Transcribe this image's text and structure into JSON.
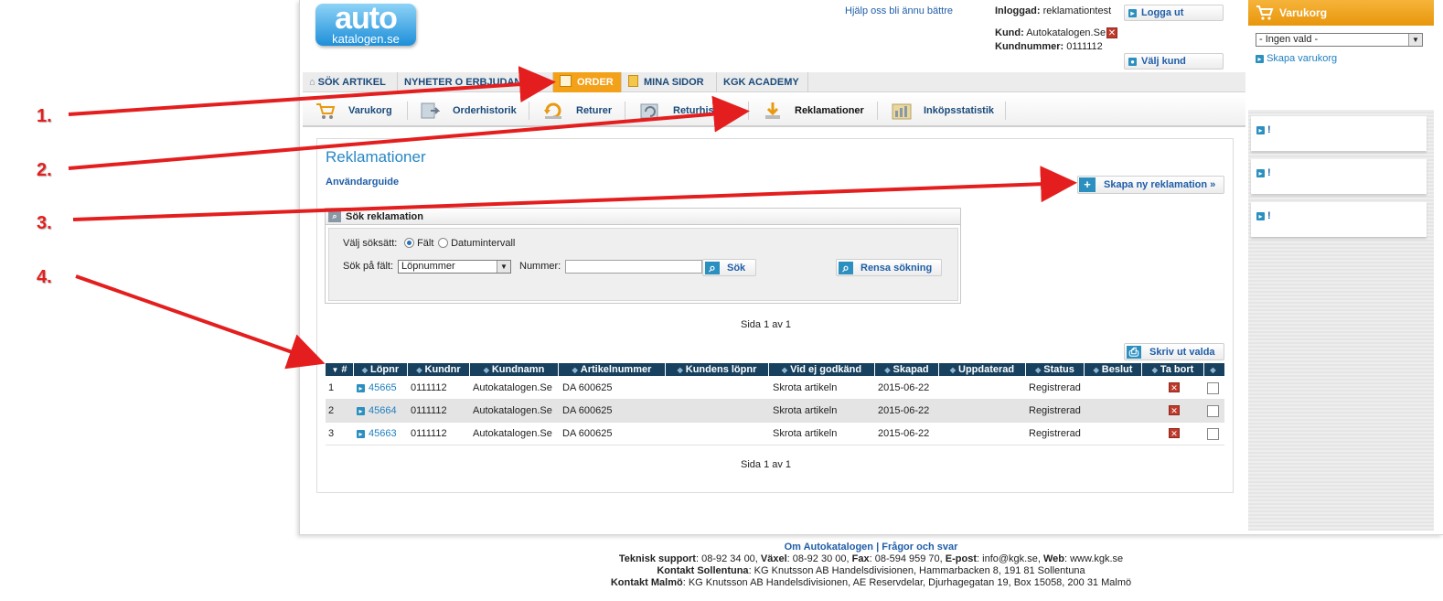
{
  "header": {
    "logo_line1": "auto",
    "logo_line2": "katalogen.se",
    "help_link": "Hjälp oss bli ännu bättre",
    "logged_in_label": "Inloggad:",
    "logged_in_user": "reklamationtest",
    "customer_label": "Kund:",
    "customer_name": "Autokatalogen.Se",
    "customer_number_label": "Kundnummer:",
    "customer_number": "0111112",
    "logout_button": "Logga ut",
    "choose_customer_button": "Välj kund"
  },
  "main_nav": [
    {
      "label": "SÖK ARTIKEL",
      "active": false,
      "icon": "home-icon"
    },
    {
      "label": "NYHETER O ERBJUDANDEN",
      "active": false
    },
    {
      "label": "ORDER",
      "active": true,
      "icon": "order-icon"
    },
    {
      "label": "MINA SIDOR",
      "active": false,
      "icon": "page-icon"
    },
    {
      "label": "KGK ACADEMY",
      "active": false
    }
  ],
  "sub_nav": [
    {
      "label": "Varukorg",
      "icon": "cart-icon"
    },
    {
      "label": "Orderhistorik",
      "icon": "order-history-icon"
    },
    {
      "label": "Returer",
      "icon": "returns-icon"
    },
    {
      "label": "Returhistorik",
      "icon": "return-history-icon"
    },
    {
      "label": "Reklamationer",
      "icon": "complaints-icon",
      "active": true
    },
    {
      "label": "Inköpsstatistik",
      "icon": "statistics-icon"
    }
  ],
  "page": {
    "title": "Reklamationer",
    "user_guide": "Användarguide",
    "create_button": "Skapa ny reklamation »",
    "print_button": "Skriv ut valda",
    "pagination_top": "Sida 1 av 1",
    "pagination_bottom": "Sida 1 av 1"
  },
  "search": {
    "title": "Sök reklamation",
    "method_label": "Välj söksätt:",
    "option_field": "Fält",
    "option_dates": "Datumintervall",
    "field_label": "Sök på fält:",
    "field_value": "Löpnummer",
    "number_label": "Nummer:",
    "number_value": "",
    "search_button": "Sök",
    "clear_button": "Rensa sökning"
  },
  "table": {
    "columns": [
      "#",
      "Löpnr",
      "Kundnr",
      "Kundnamn",
      "Artikelnummer",
      "Kundens löpnr",
      "Vid ej godkänd",
      "Skapad",
      "Uppdaterad",
      "Status",
      "Beslut",
      "Ta bort",
      ""
    ],
    "rows": [
      {
        "n": "1",
        "lopnr": "45665",
        "kundnr": "0111112",
        "kundnamn": "Autokatalogen.Se",
        "artikel": "DA 600625",
        "kundens_lopnr": "",
        "vid_ej": "Skrota artikeln",
        "skapad": "2015-06-22",
        "uppdaterad": "",
        "status": "Registrerad",
        "beslut": ""
      },
      {
        "n": "2",
        "lopnr": "45664",
        "kundnr": "0111112",
        "kundnamn": "Autokatalogen.Se",
        "artikel": "DA 600625",
        "kundens_lopnr": "",
        "vid_ej": "Skrota artikeln",
        "skapad": "2015-06-22",
        "uppdaterad": "",
        "status": "Registrerad",
        "beslut": ""
      },
      {
        "n": "3",
        "lopnr": "45663",
        "kundnr": "0111112",
        "kundnamn": "Autokatalogen.Se",
        "artikel": "DA 600625",
        "kundens_lopnr": "",
        "vid_ej": "Skrota artikeln",
        "skapad": "2015-06-22",
        "uppdaterad": "",
        "status": "Registrerad",
        "beslut": ""
      }
    ]
  },
  "sidebar": {
    "title": "Varukorg",
    "select_value": "- Ingen vald -",
    "create_cart": "Skapa varukorg",
    "cards": [
      "!",
      "!",
      "!"
    ]
  },
  "footer": {
    "link_about": "Om Autokatalogen",
    "separator": "|",
    "link_faq": "Frågor och svar",
    "line2_label1": "Teknisk support",
    "line2_val1": ": 08-92 34 00,",
    "line2_label2": "Växel",
    "line2_val2": ": 08-92 30 00,",
    "line2_label3": "Fax",
    "line2_val3": ": 08-594 959 70,",
    "line2_label4": "E-post",
    "line2_val4": ": info@kgk.se,",
    "line2_label5": "Web",
    "line2_val5": ": www.kgk.se",
    "line3_label": "Kontakt Sollentuna",
    "line3_val": ": KG Knutsson AB Handelsdivisionen, Hammarbacken 8, 191 81 Sollentuna",
    "line4_label": "Kontakt Malmö",
    "line4_val": ": KG Knutsson AB Handelsdivisionen, AE Reservdelar, Djurhagegatan 19, Box 15058, 200 31 Malmö"
  },
  "annotations": [
    "1.",
    "2.",
    "3.",
    "4."
  ],
  "colors": {
    "accent_orange": "#f4a11a",
    "nav_text": "#1a4a7a",
    "table_header": "#17415f",
    "title_blue": "#2787c5",
    "arrow_red": "#e41e1e"
  }
}
